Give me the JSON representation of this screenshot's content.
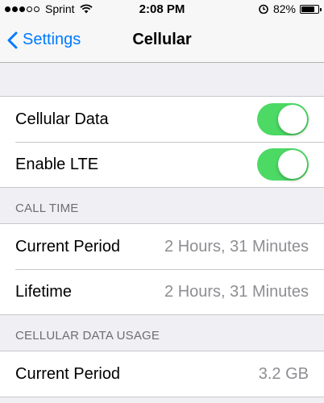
{
  "status_bar": {
    "carrier": "Sprint",
    "time": "2:08 PM",
    "battery_percent": "82%",
    "battery_level": 0.82,
    "signal_bars_filled": 3,
    "signal_bars_total": 5,
    "icons": [
      "wifi-icon",
      "alarm-icon",
      "battery-icon"
    ]
  },
  "nav": {
    "back_label": "Settings",
    "title": "Cellular",
    "accent_color": "#007aff"
  },
  "toggles_group": {
    "items": [
      {
        "label": "Cellular Data",
        "on": true
      },
      {
        "label": "Enable LTE",
        "on": true
      }
    ],
    "toggle_on_color": "#4cd964"
  },
  "call_time": {
    "header": "CALL TIME",
    "rows": [
      {
        "label": "Current Period",
        "value": "2 Hours, 31 Minutes"
      },
      {
        "label": "Lifetime",
        "value": "2 Hours, 31 Minutes"
      }
    ]
  },
  "data_usage": {
    "header": "CELLULAR DATA USAGE",
    "rows": [
      {
        "label": "Current Period",
        "value": "3.2 GB"
      }
    ]
  }
}
